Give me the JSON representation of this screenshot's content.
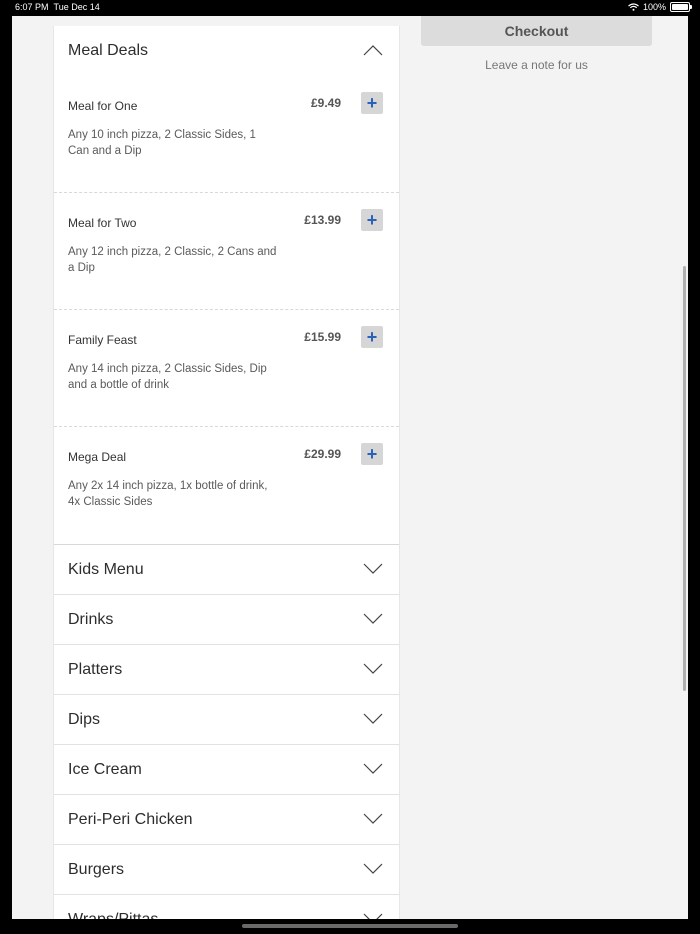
{
  "status": {
    "time": "6:07 PM",
    "date": "Tue Dec 14",
    "battery": "100%",
    "battery_level": 1.0
  },
  "sidebar": {
    "checkout_label": "Checkout",
    "note_link": "Leave a note for us"
  },
  "menu": {
    "expanded": {
      "title": "Meal Deals",
      "items": [
        {
          "name": "Meal for One",
          "price": "£9.49",
          "desc": "Any 10 inch pizza, 2 Classic Sides, 1 Can and a Dip"
        },
        {
          "name": "Meal for Two",
          "price": "£13.99",
          "desc": "Any 12 inch pizza, 2 Classic, 2 Cans and a Dip"
        },
        {
          "name": "Family Feast",
          "price": "£15.99",
          "desc": "Any 14 inch pizza, 2 Classic Sides, Dip and a bottle of drink"
        },
        {
          "name": "Mega Deal",
          "price": "£29.99",
          "desc": "Any 2x 14 inch pizza, 1x bottle of drink, 4x Classic Sides"
        }
      ]
    },
    "collapsed": [
      "Kids Menu",
      "Drinks",
      "Platters",
      "Dips",
      "Ice Cream",
      "Peri-Peri Chicken",
      "Burgers",
      "Wraps/Pittas"
    ],
    "icons": {
      "expand": "chevron-down-icon",
      "collapse": "chevron-up-icon",
      "add": "plus-icon"
    },
    "add_symbol": "+"
  },
  "colors": {
    "accent": "#2a62b8",
    "button_bg": "#d6d6d6",
    "checkout_bg": "#dcdcdc"
  }
}
